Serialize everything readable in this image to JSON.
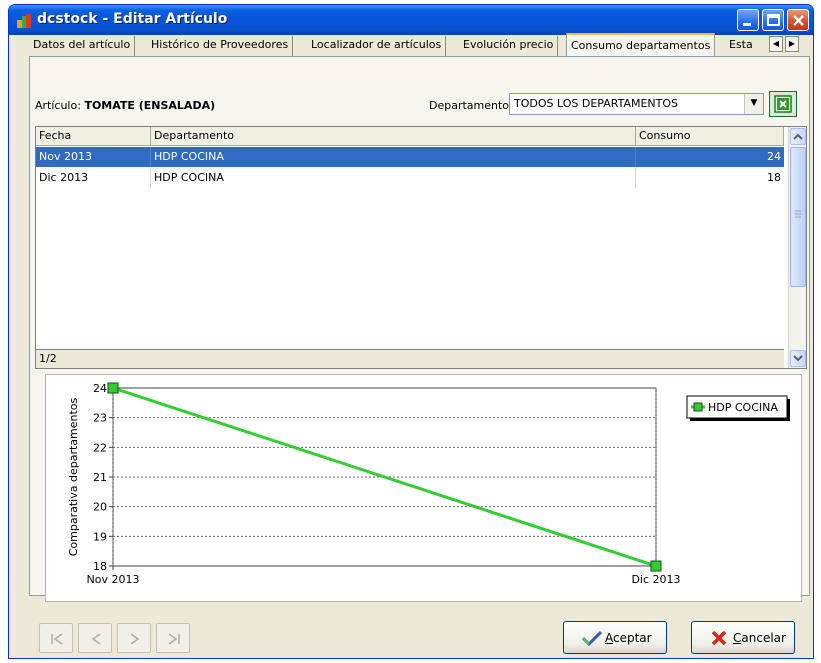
{
  "window": {
    "title": "dcstock - Editar Artículo"
  },
  "tabs": [
    {
      "label": "Datos del artículo"
    },
    {
      "label": "Histórico de Proveedores"
    },
    {
      "label": "Localizador de artículos"
    },
    {
      "label": "Evolución precio"
    },
    {
      "label": "Consumo departamentos",
      "active": true
    },
    {
      "label": "Esta"
    }
  ],
  "article": {
    "label": "Artículo:",
    "name": "TOMATE (ENSALADA)"
  },
  "department": {
    "label": "Departamento",
    "value": "TODOS LOS DEPARTAMENTOS"
  },
  "grid": {
    "columns": [
      "Fecha",
      "Departamento",
      "Consumo"
    ],
    "rows": [
      {
        "fecha": "Nov 2013",
        "departamento": "HDP COCINA",
        "consumo": "24",
        "selected": true
      },
      {
        "fecha": "Dic 2013",
        "departamento": "HDP COCINA",
        "consumo": "18",
        "selected": false
      }
    ],
    "footer": "1/2"
  },
  "chart_data": {
    "type": "line",
    "ylabel": "Comparativa departamentos",
    "categories": [
      "Nov 2013",
      "Dic 2013"
    ],
    "ylim": [
      18,
      24
    ],
    "yticks": [
      24,
      23,
      22,
      21,
      20,
      19,
      18
    ],
    "grid": true,
    "legend": "top-right",
    "series": [
      {
        "name": "HDP COCINA",
        "values": [
          24,
          18
        ],
        "color": "#33cc33"
      }
    ]
  },
  "buttons": {
    "accept": {
      "label": "Aceptar"
    },
    "cancel": {
      "label": "Cancelar"
    }
  },
  "icons": {
    "app": "app-logo-icon",
    "minimize": "minimize-icon",
    "maximize": "maximize-icon",
    "close": "close-icon",
    "excel": "excel-export-icon",
    "nav": [
      "first-record-icon",
      "prev-record-icon",
      "next-record-icon",
      "last-record-icon"
    ]
  },
  "colors": {
    "titlebar": "#0754d8",
    "selection": "#316ac5",
    "series_line": "#33cc33",
    "active_tab_accent": "#f5b83b"
  }
}
